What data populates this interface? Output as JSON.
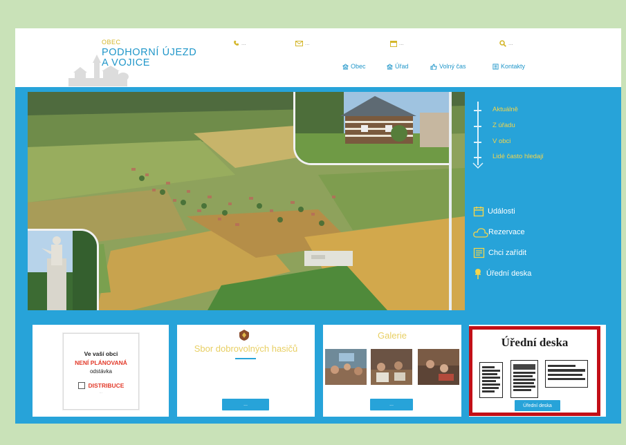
{
  "header": {
    "logo_small": "OBEC",
    "logo_line1": "PODHORNÍ ÚJEZD",
    "logo_line2": "A VOJICE",
    "contacts": [
      {
        "icon": "phone-icon",
        "text": "..."
      },
      {
        "icon": "email-icon",
        "text": "..."
      },
      {
        "icon": "calendar-icon",
        "text": "..."
      },
      {
        "icon": "search-icon",
        "text": "..."
      }
    ],
    "nav": [
      {
        "icon": "building-icon",
        "label": "Obec"
      },
      {
        "icon": "building-icon",
        "label": "Úřad"
      },
      {
        "icon": "thumbs-up-icon",
        "label": "Volný čas"
      },
      {
        "icon": "book-icon",
        "label": "Kontakty"
      }
    ]
  },
  "timeline": {
    "items": [
      "Aktuálně",
      "Z úřadu",
      "V obci",
      "Lidé často hledají"
    ]
  },
  "sidelinks": [
    {
      "icon": "calendar-icon",
      "label": "Události"
    },
    {
      "icon": "cloud-icon",
      "label": "Rezervace"
    },
    {
      "icon": "form-icon",
      "label": "Chci zařídit"
    },
    {
      "icon": "pin-icon",
      "label": "Úřední deska"
    }
  ],
  "cards": {
    "distribuce": {
      "line1": "Ve vaší obci",
      "line2": "NENÍ PLÁNOVANÁ",
      "line3": "odstávka",
      "brand": "DISTRIBUCE",
      "fine": "..."
    },
    "hasici": {
      "title": "Sbor dobrovolných hasičů",
      "button": "..."
    },
    "galerie": {
      "title": "Galerie",
      "button": "..."
    },
    "deska": {
      "title": "Úřední deska",
      "button": "Úřední deska"
    }
  },
  "colors": {
    "page_bg": "#c9e2b8",
    "site_blue": "#27a3d9",
    "accent_yellow": "#f4d54b",
    "frame_red": "#c20f17"
  }
}
